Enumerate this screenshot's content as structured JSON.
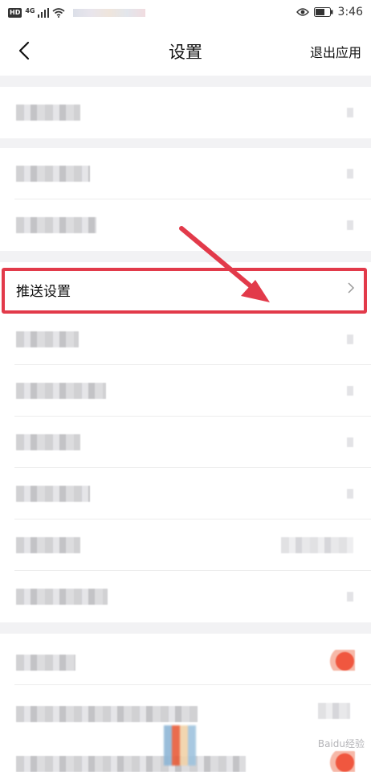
{
  "status_bar": {
    "hd_label": "HD",
    "network_label": "4G",
    "time": "3:46"
  },
  "nav": {
    "title": "设置",
    "exit_label": "退出应用"
  },
  "push_settings": {
    "label": "推送设置"
  },
  "watermark": "Baidu经验",
  "colors": {
    "highlight": "#e23a4a",
    "toggle_on": "#f0573f",
    "background": "#f2f2f4"
  }
}
